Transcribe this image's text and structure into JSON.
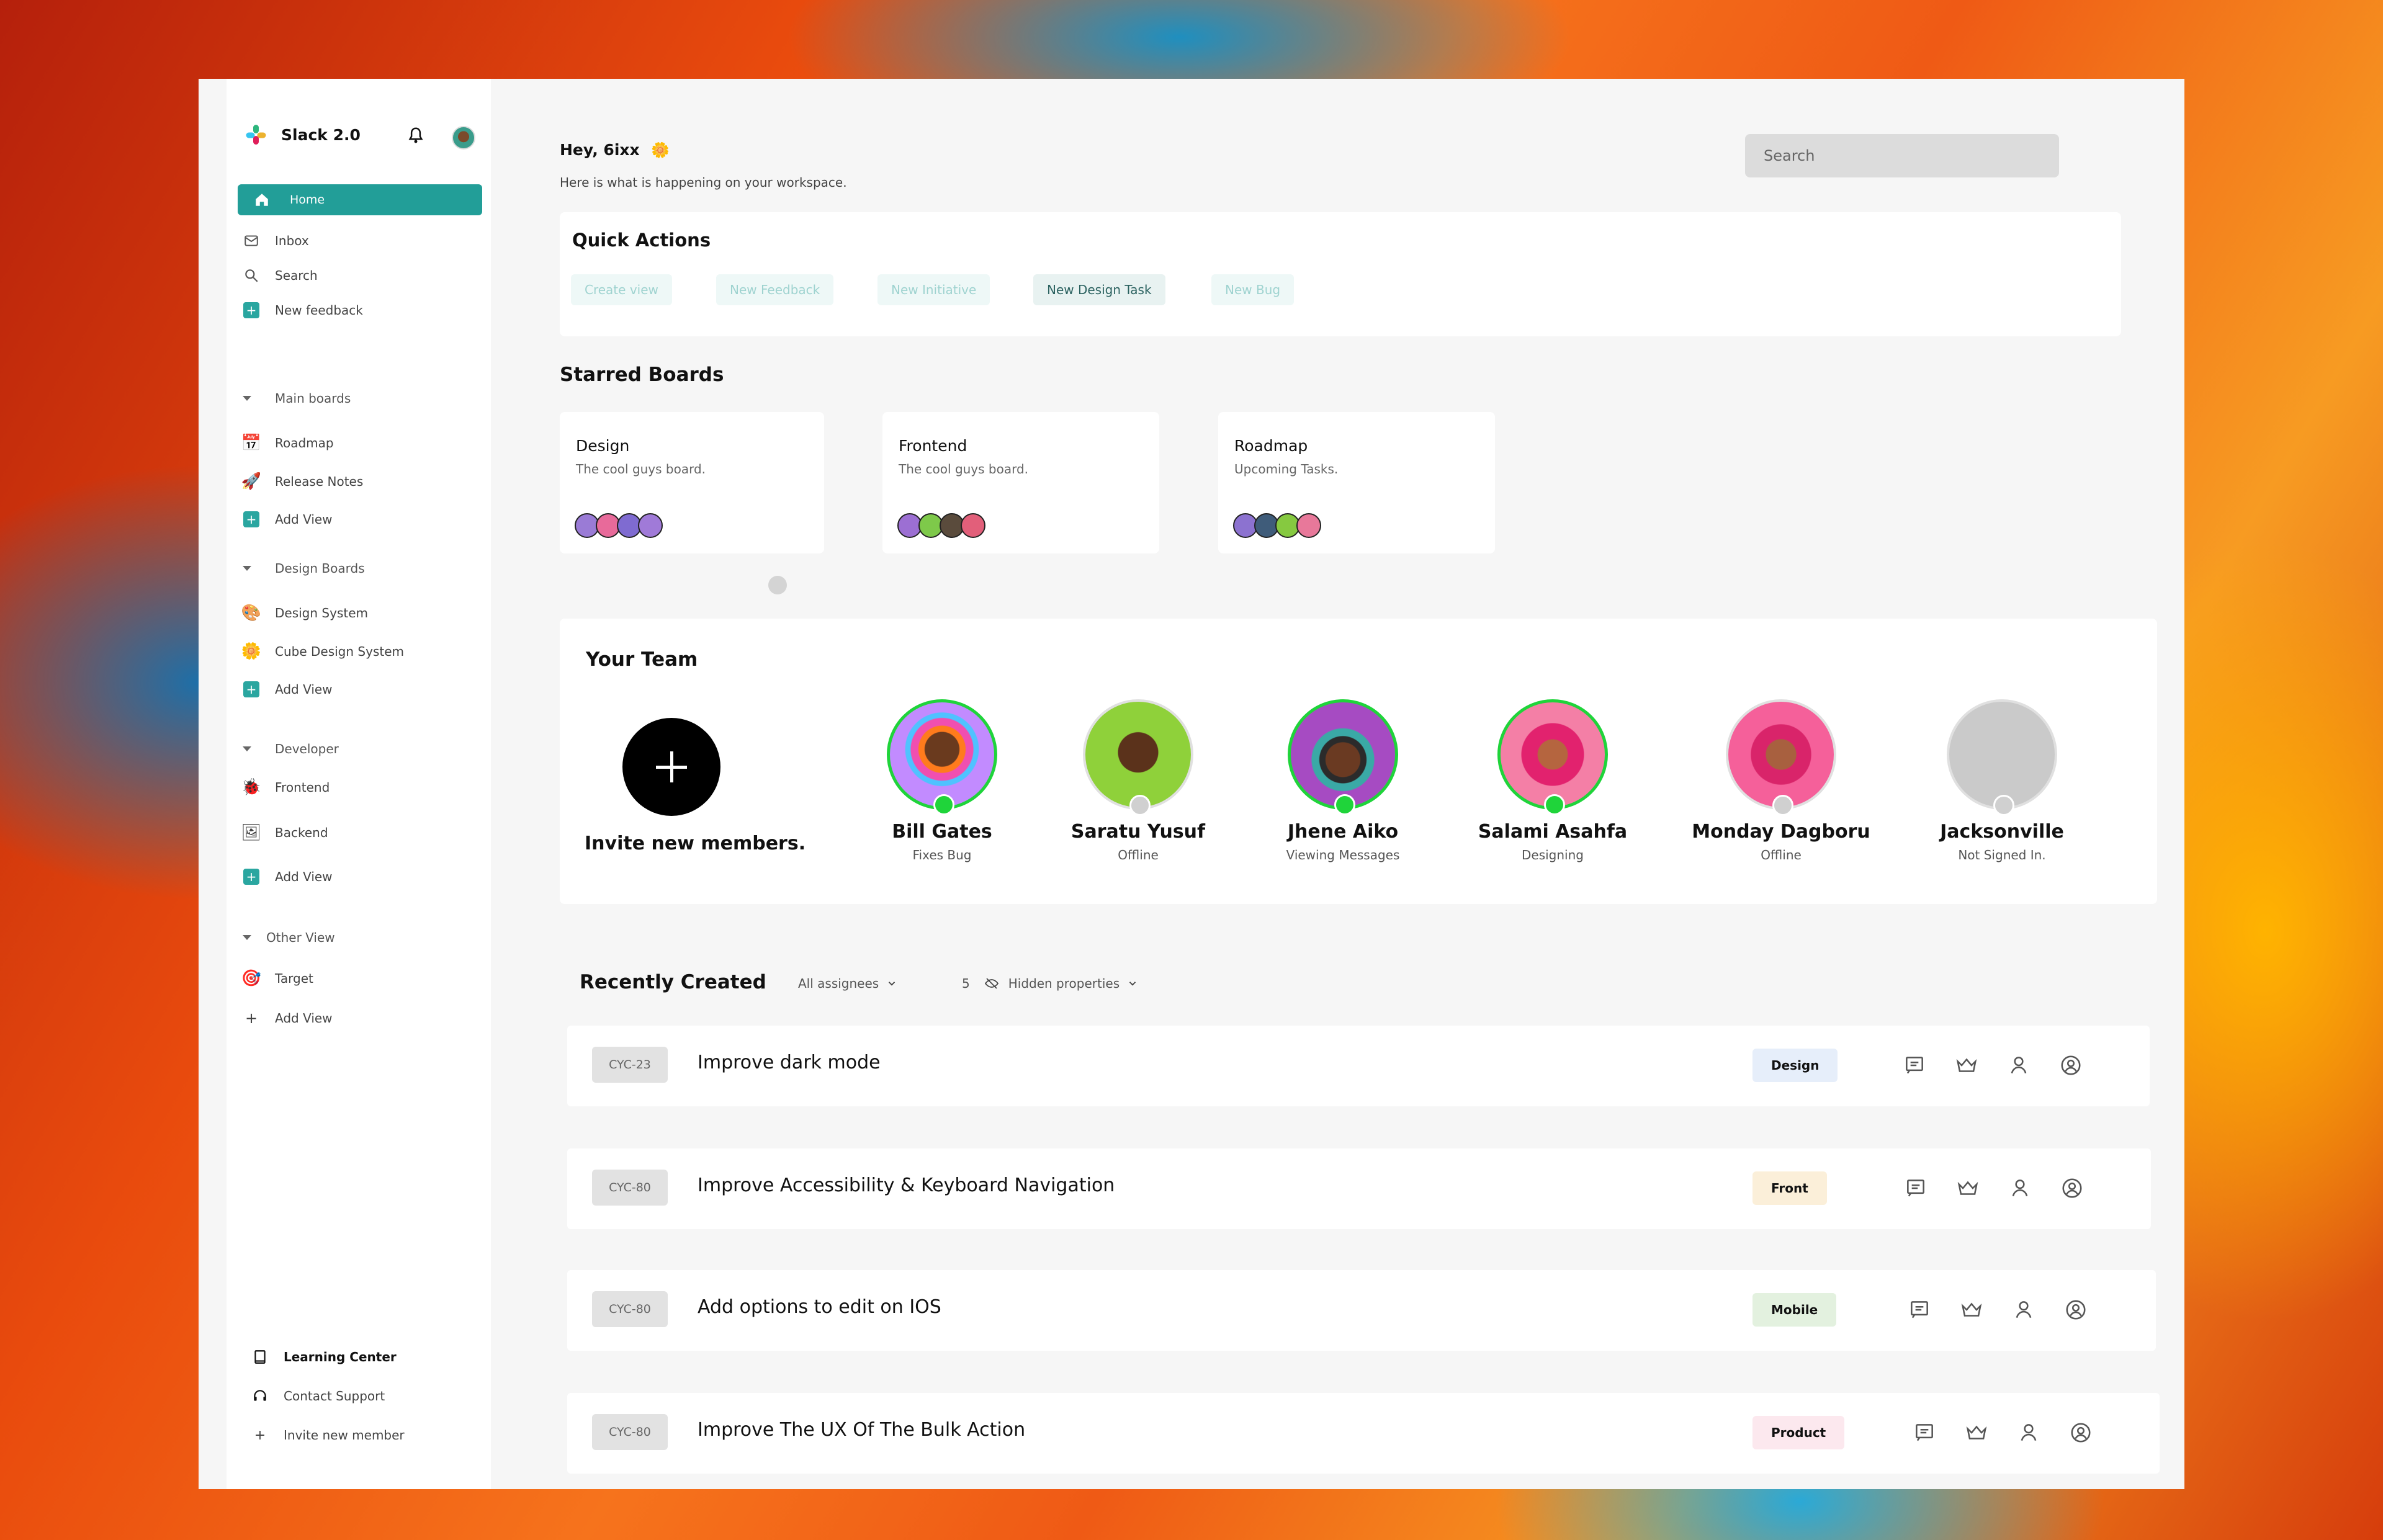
{
  "app": {
    "name": "Slack 2.0"
  },
  "sidebar": {
    "home": "Home",
    "items": [
      {
        "label": "Inbox",
        "icon": "mail-icon"
      },
      {
        "label": "Search",
        "icon": "search-icon"
      },
      {
        "label": "New feedback",
        "icon": "plus-icon"
      }
    ],
    "sections": [
      {
        "title": "Main boards",
        "items": [
          {
            "label": "Roadmap",
            "icon": "calendar-icon"
          },
          {
            "label": "Release Notes",
            "icon": "rocket-icon"
          },
          {
            "label": "Add View",
            "icon": "plus-icon"
          }
        ]
      },
      {
        "title": "Design Boards",
        "items": [
          {
            "label": "Design System",
            "icon": "palette-icon"
          },
          {
            "label": "Cube Design System",
            "icon": "sun-icon"
          },
          {
            "label": "Add View",
            "icon": "plus-icon"
          }
        ]
      },
      {
        "title": "Developer",
        "items": [
          {
            "label": "Frontend",
            "icon": "bug-icon"
          },
          {
            "label": "Backend",
            "icon": "frame-icon"
          },
          {
            "label": "Add View",
            "icon": "plus-icon"
          }
        ]
      },
      {
        "title": "Other View",
        "items": [
          {
            "label": "Target",
            "icon": "target-icon"
          },
          {
            "label": "Add View",
            "icon": "plus-icon"
          }
        ]
      }
    ],
    "footer": [
      {
        "label": "Learning Center",
        "icon": "book-icon"
      },
      {
        "label": "Contact Support",
        "icon": "headset-icon"
      },
      {
        "label": "Invite new member",
        "icon": "plus-icon"
      }
    ]
  },
  "header": {
    "greeting": "Hey, 6ixx",
    "subtitle": "Here is what is happening on your workspace.",
    "search_placeholder": "Search"
  },
  "quick_actions": {
    "title": "Quick Actions",
    "chips": [
      "Create view",
      "New Feedback",
      "New Initiative",
      "New Design Task",
      "New Bug"
    ]
  },
  "starred": {
    "title": "Starred Boards",
    "boards": [
      {
        "title": "Design",
        "subtitle": "The cool guys board."
      },
      {
        "title": "Frontend",
        "subtitle": "The cool guys board."
      },
      {
        "title": "Roadmap",
        "subtitle": "Upcoming Tasks."
      }
    ]
  },
  "team": {
    "title": "Your Team",
    "invite_label": "Invite new members.",
    "members": [
      {
        "name": "Bill Gates",
        "status": "Fixes Bug",
        "online": true
      },
      {
        "name": "Saratu Yusuf",
        "status": "Offline",
        "online": false
      },
      {
        "name": "Jhene Aiko",
        "status": "Viewing Messages",
        "online": true
      },
      {
        "name": "Salami Asahfa",
        "status": "Designing",
        "online": true
      },
      {
        "name": "Monday Dagboru",
        "status": "Offline",
        "online": false
      },
      {
        "name": "Jacksonville",
        "status": "Not Signed In.",
        "online": false
      }
    ]
  },
  "recent": {
    "title": "Recently Created",
    "filter_assignees": "All assignees",
    "hidden_count": "5",
    "hidden_label": "Hidden properties",
    "rows": [
      {
        "id": "CYC-23",
        "title": "Improve dark mode",
        "tag": "Design",
        "tag_color": "#e6eefa"
      },
      {
        "id": "CYC-80",
        "title": "Improve Accessibility & Keyboard Navigation",
        "tag": "Front",
        "tag_color": "#fbefd9"
      },
      {
        "id": "CYC-80",
        "title": "Add options to edit on IOS",
        "tag": "Mobile",
        "tag_color": "#e3f1df"
      },
      {
        "id": "CYC-80",
        "title": "Improve The UX Of The Bulk Action",
        "tag": "Product",
        "tag_color": "#fce8ee"
      }
    ]
  },
  "colors": {
    "accent": "#229e98",
    "online": "#1fd43a",
    "offline": "#d0d0d0"
  }
}
